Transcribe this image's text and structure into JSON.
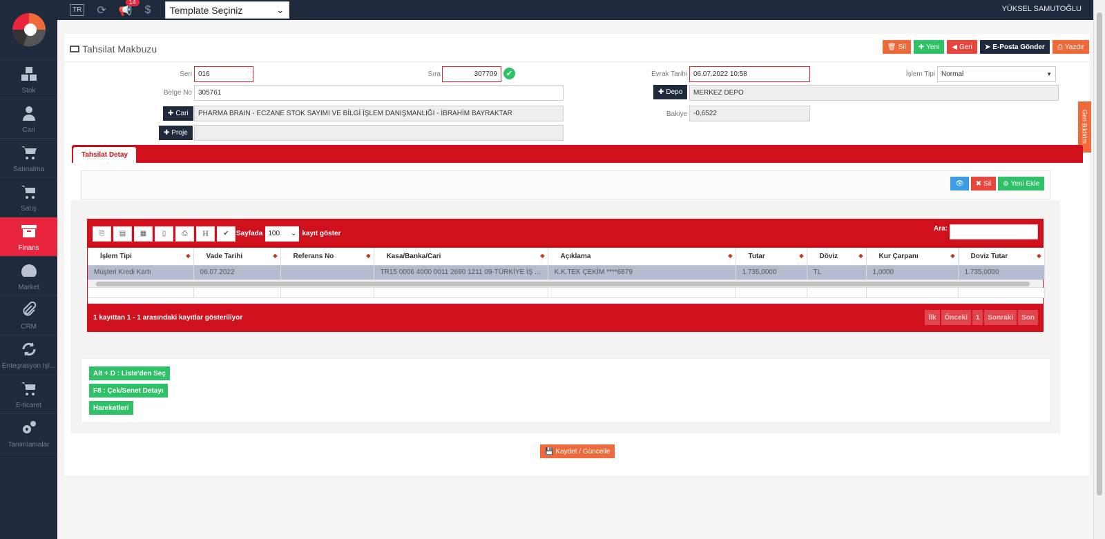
{
  "topbar": {
    "lang": "TR",
    "notification_count": "14",
    "template_select": "Template Seçiniz",
    "username": "YÜKSEL SAMUTOĞLU"
  },
  "sidebar": {
    "items": [
      {
        "label": "Stok",
        "icon": "cubes-icon"
      },
      {
        "label": "Cari",
        "icon": "user-icon"
      },
      {
        "label": "Satınalma",
        "icon": "cart-icon"
      },
      {
        "label": "Satış",
        "icon": "cart-icon"
      },
      {
        "label": "Finans",
        "icon": "archive-icon",
        "active": true
      },
      {
        "label": "Market",
        "icon": "dashboard-icon"
      },
      {
        "label": "CRM",
        "icon": "paperclip-icon"
      },
      {
        "label": "Entegrasyon İşl...",
        "icon": "refresh-icon"
      },
      {
        "label": "E-ticaret",
        "icon": "cart-icon"
      },
      {
        "label": "Tanımlamalar",
        "icon": "gears-icon"
      }
    ]
  },
  "page": {
    "title": "Tahsilat Makbuzu",
    "actions": {
      "delete": "Sil",
      "new": "Yeni",
      "back": "Geri",
      "email": "E-Posta Gönder",
      "print": "Yazdır"
    },
    "side_tab": "Geri Bildirim"
  },
  "form": {
    "seri_label": "Seri",
    "seri_value": "016",
    "sira_label": "Sıra",
    "sira_value": "307709",
    "evrak_tarihi_label": "Evrak Tarihi",
    "evrak_tarihi_value": "06.07.2022 10:58",
    "islem_tipi_label": "İşlem Tipi",
    "islem_tipi_value": "Normal",
    "belge_no_label": "Belge No",
    "belge_no_value": "305761",
    "depo_button": "Depo",
    "depo_value": "MERKEZ DEPO",
    "cari_button": "Cari",
    "cari_value": "PHARMA BRAIN - ECZANE STOK SAYIMI VE BİLGİ İŞLEM DANIŞMANLIĞI - İBRAHİM BAYRAKTAR",
    "bakiye_label": "Bakiye",
    "bakiye_value": "-0,6522",
    "proje_button": "Proje",
    "proje_value": ""
  },
  "tabs": {
    "detail": "Tahsilat Detay"
  },
  "detail_actions": {
    "delete": "Sil",
    "add": "Yeni Ekle"
  },
  "grid": {
    "tool_h": "H",
    "per_page_label": "Sayfada",
    "per_page_value": "100",
    "show_records": "kayıt göster",
    "search_label": "Ara:",
    "columns": [
      "İşlem Tipi",
      "Vade Tarihi",
      "Referans No",
      "Kasa/Banka/Cari",
      "Açıklama",
      "Tutar",
      "Döviz",
      "Kur Çarpanı",
      "Doviz Tutar"
    ],
    "rows": [
      [
        "Müşteri Kredi Kartı",
        "06.07.2022",
        "",
        "TR15 0006 4000 0011 2690 1211 09-TÜRKİYE İŞ ...",
        "K.K.TEK ÇEKİM ****6879",
        "1.735,0000",
        "TL",
        "1,0000",
        "1.735,0000"
      ]
    ],
    "info": "1 kayıttan 1 - 1 arasındaki kayıtlar gösteriliyor",
    "pager": {
      "first": "İlk",
      "prev": "Önceki",
      "page": "1",
      "next": "Sonraki",
      "last": "Son"
    }
  },
  "shortcuts": {
    "list_select": "Alt + D : Liste'den Seç",
    "cek_senet": "F8 : Çek/Senet Detayı",
    "hareketler": "Hareketleri"
  },
  "save_button": "Kaydet / Güncelle",
  "colors": {
    "primary_red": "#d0101c",
    "sidebar_bg": "#1f2a3d",
    "orange": "#ef6a3a",
    "green": "#2ec167"
  }
}
